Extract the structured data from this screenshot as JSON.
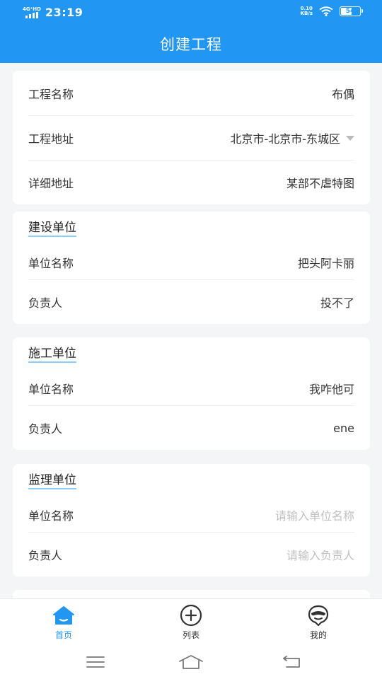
{
  "status_bar": {
    "network": "4G⁺HD",
    "time": "23:19",
    "speed_value": "0.10",
    "speed_unit": "KB/s",
    "battery": "54"
  },
  "header": {
    "title": "创建工程"
  },
  "project": {
    "rows": [
      {
        "label": "工程名称",
        "value": "布偶"
      },
      {
        "label": "工程地址",
        "value": "北京市-北京市-东城区"
      },
      {
        "label": "详细地址",
        "value": "某部不虐特图"
      }
    ]
  },
  "construction_unit": {
    "title": "建设单位",
    "name_label": "单位名称",
    "name_value": "把头阿卡丽",
    "person_label": "负责人",
    "person_value": "投不了"
  },
  "building_unit": {
    "title": "施工单位",
    "name_label": "单位名称",
    "name_value": "我咋他可",
    "person_label": "负责人",
    "person_value": "ene"
  },
  "supervision_unit": {
    "title": "监理单位",
    "name_label": "单位名称",
    "name_placeholder": "请输入单位名称",
    "person_label": "负责人",
    "person_placeholder": "请输入负责人"
  },
  "tabbar": {
    "home": "首页",
    "list": "列表",
    "mine": "我的"
  },
  "colors": {
    "primary": "#2196f3",
    "placeholder": "#c0c0c0",
    "title_underline": "#8ecff8"
  },
  "icons": {
    "home": "home-icon",
    "list": "plus-circle-icon",
    "mine": "face-icon"
  }
}
